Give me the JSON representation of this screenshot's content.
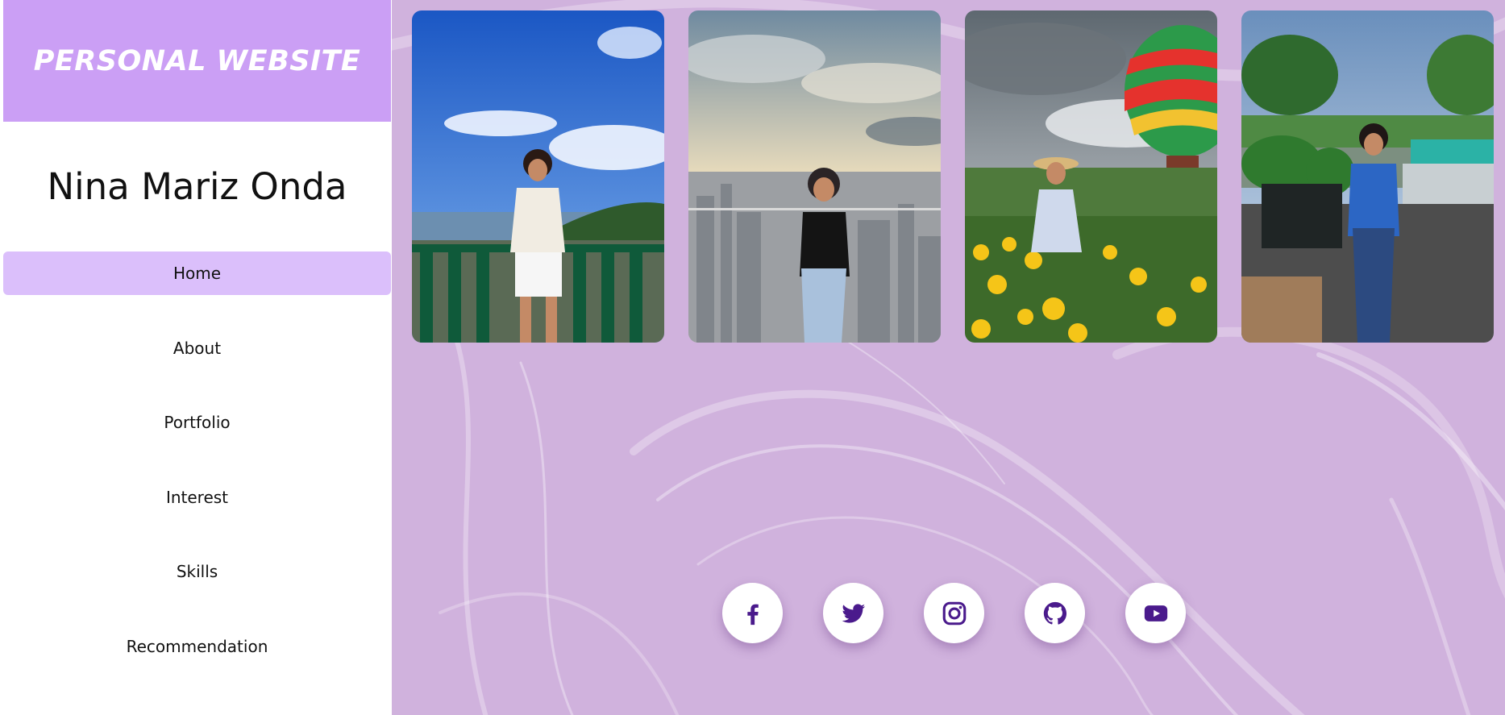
{
  "site": {
    "brand_title": "PERSONAL WEBSITE",
    "owner_name": "Nina Mariz Onda"
  },
  "nav": {
    "items": [
      {
        "label": "Home",
        "active": true
      },
      {
        "label": "About"
      },
      {
        "label": "Portfolio"
      },
      {
        "label": "Interest"
      },
      {
        "label": "Skills"
      },
      {
        "label": "Recommendation"
      }
    ]
  },
  "gallery": {
    "photos": [
      {
        "scene": "lakeside-viewpoint"
      },
      {
        "scene": "city-skyline"
      },
      {
        "scene": "flower-garden-hot-air-balloon"
      },
      {
        "scene": "park-pond"
      }
    ]
  },
  "social": {
    "links": [
      {
        "icon": "facebook-icon"
      },
      {
        "icon": "twitter-icon"
      },
      {
        "icon": "instagram-icon"
      },
      {
        "icon": "github-icon"
      },
      {
        "icon": "youtube-icon"
      }
    ]
  },
  "colors": {
    "brand_bg": "#cb9ff5",
    "nav_active_bg": "#dbbffb",
    "main_bg": "#d0b2dd",
    "icon_color": "#4a1a8c"
  }
}
